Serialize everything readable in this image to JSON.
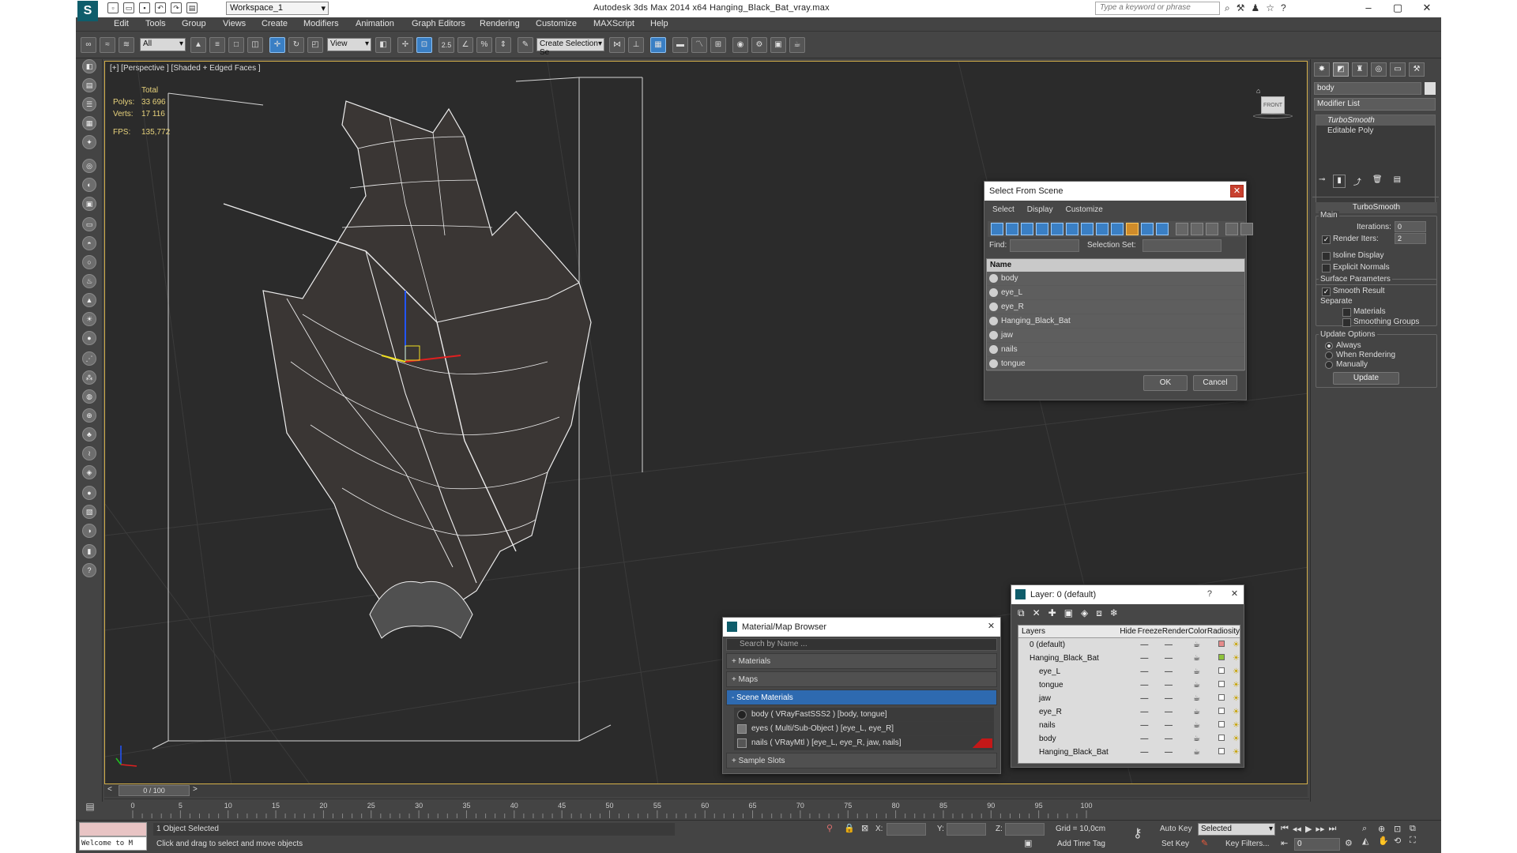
{
  "window": {
    "title": "Autodesk 3ds Max  2014 x64      Hanging_Black_Bat_vray.max",
    "workspace": "Workspace_1",
    "search_placeholder": "Type a keyword or phrase"
  },
  "menu": [
    "Edit",
    "Tools",
    "Group",
    "Views",
    "Create",
    "Modifiers",
    "Animation",
    "Graph Editors",
    "Rendering",
    "Customize",
    "MAXScript",
    "Help"
  ],
  "toolbar": {
    "filter": "All",
    "ref_coord": "View",
    "snap_label": "2.5",
    "selection_set": "Create Selection Se"
  },
  "viewport": {
    "label": "[+] [Perspective ] [Shaded + Edged Faces ]",
    "stats": {
      "header": "Total",
      "polys_label": "Polys:",
      "polys": "33 696",
      "verts_label": "Verts:",
      "verts": "17 116",
      "fps_label": "FPS:",
      "fps": "135,772"
    },
    "viewcube_label": "FRONT"
  },
  "select_dialog": {
    "title": "Select From Scene",
    "menu": [
      "Select",
      "Display",
      "Customize"
    ],
    "find_label": "Find:",
    "selection_set_label": "Selection Set:",
    "column": "Name",
    "items": [
      "body",
      "eye_L",
      "eye_R",
      "Hanging_Black_Bat",
      "jaw",
      "nails",
      "tongue"
    ],
    "ok": "OK",
    "cancel": "Cancel"
  },
  "material_browser": {
    "title": "Material/Map Browser",
    "search_placeholder": "Search by Name ...",
    "sections": [
      "+ Materials",
      "+ Maps",
      "- Scene Materials",
      "+ Sample Slots"
    ],
    "scene_materials": [
      "body  ( VRayFastSSS2 ) [body, tongue]",
      "eyes  ( Multi/Sub-Object ) [eye_L, eye_R]",
      "nails  ( VRayMtl ) [eye_L, eye_R, jaw, nails]"
    ]
  },
  "layer_dialog": {
    "title": "Layer: 0 (default)",
    "help": "?",
    "columns": [
      "Layers",
      "Hide",
      "Freeze",
      "Render",
      "Color",
      "Radiosity"
    ],
    "layers": [
      {
        "name": "0 (default)",
        "indent": 0,
        "color": "#e58a8a"
      },
      {
        "name": "Hanging_Black_Bat",
        "indent": 0,
        "color": "#8ec23a"
      },
      {
        "name": "eye_L",
        "indent": 1
      },
      {
        "name": "tongue",
        "indent": 1
      },
      {
        "name": "jaw",
        "indent": 1
      },
      {
        "name": "eye_R",
        "indent": 1
      },
      {
        "name": "nails",
        "indent": 1
      },
      {
        "name": "body",
        "indent": 1
      },
      {
        "name": "Hanging_Black_Bat",
        "indent": 1
      }
    ]
  },
  "command_panel": {
    "object_name": "body",
    "modifier_list": "Modifier List",
    "stack": [
      "TurboSmooth",
      "Editable Poly"
    ],
    "rollout": "TurboSmooth",
    "main": "Main",
    "iterations_label": "Iterations:",
    "iterations": "0",
    "render_iters_label": "Render Iters:",
    "render_iters": "2",
    "isoline": "Isoline Display",
    "explicit_normals": "Explicit Normals",
    "surface_params": "Surface Parameters",
    "smooth_result": "Smooth Result",
    "separate": "Separate",
    "materials": "Materials",
    "smoothing_groups": "Smoothing Groups",
    "update_options": "Update Options",
    "always": "Always",
    "when_rendering": "When Rendering",
    "manually": "Manually",
    "update_btn": "Update"
  },
  "timeline": {
    "frame": "0 / 100",
    "ticks": [
      "0",
      "5",
      "10",
      "15",
      "20",
      "25",
      "30",
      "35",
      "40",
      "45",
      "50",
      "55",
      "60",
      "65",
      "70",
      "75",
      "80",
      "85",
      "90",
      "95",
      "100"
    ]
  },
  "status": {
    "maxscript": "Welcome to M",
    "selected": "1 Object Selected",
    "prompt": "Click and drag to select and move objects",
    "x_label": "X:",
    "y_label": "Y:",
    "z_label": "Z:",
    "grid": "Grid = 10,0cm",
    "add_time_tag": "Add Time Tag",
    "auto_key": "Auto Key",
    "set_key": "Set Key",
    "selected_dd": "Selected",
    "key_filters": "Key Filters...",
    "frame": "0"
  }
}
